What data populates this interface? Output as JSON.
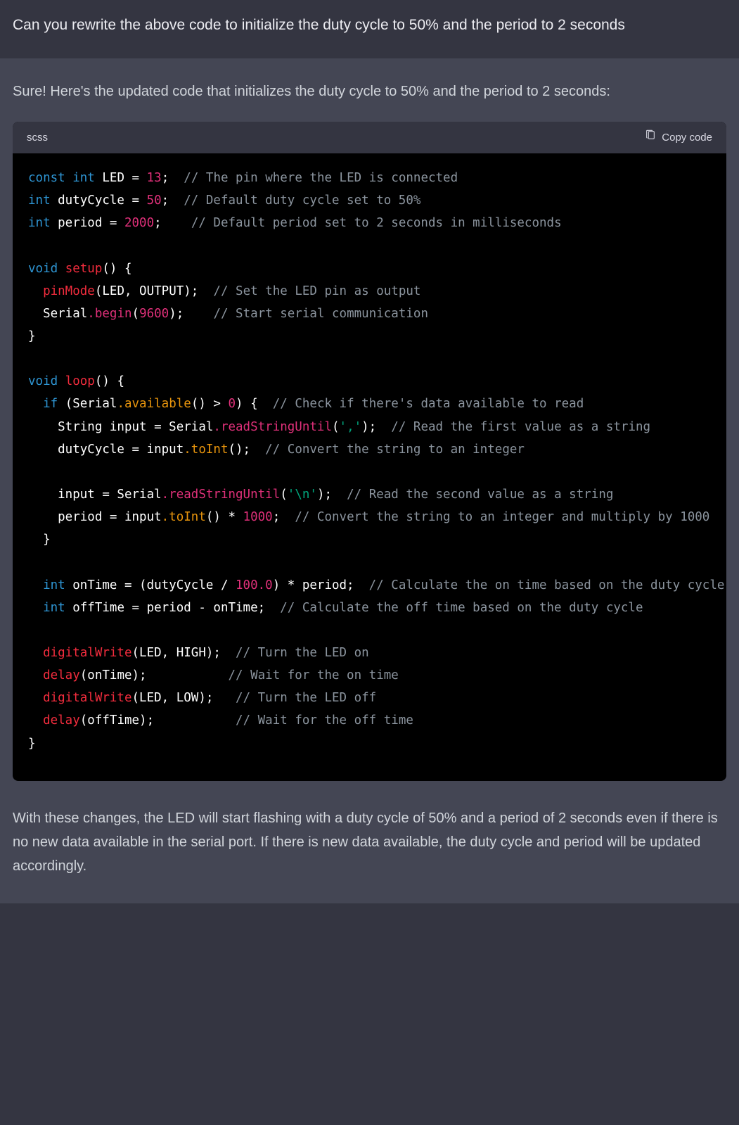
{
  "user": {
    "text": "Can you rewrite the above code to initialize the duty cycle to 50% and the period to 2 seconds"
  },
  "assistant": {
    "intro": "Sure! Here's the updated code that initializes the duty cycle to 50% and the period to 2 seconds:",
    "outro": "With these changes, the LED will start flashing with a duty cycle of 50% and a period of 2 seconds even if there is no new data available in the serial port. If there is new data available, the duty cycle and period will be updated accordingly."
  },
  "code_block": {
    "language": "scss",
    "copy_label": "Copy code",
    "lines": [
      [
        [
          "kw",
          "const"
        ],
        [
          "id",
          " "
        ],
        [
          "type",
          "int"
        ],
        [
          "id",
          " LED = "
        ],
        [
          "num",
          "13"
        ],
        [
          "id",
          ";  "
        ],
        [
          "com",
          "// The pin where the LED is connected"
        ]
      ],
      [
        [
          "type",
          "int"
        ],
        [
          "id",
          " dutyCycle = "
        ],
        [
          "num",
          "50"
        ],
        [
          "id",
          ";  "
        ],
        [
          "com",
          "// Default duty cycle set to 50%"
        ]
      ],
      [
        [
          "type",
          "int"
        ],
        [
          "id",
          " period = "
        ],
        [
          "num",
          "2000"
        ],
        [
          "id",
          ";    "
        ],
        [
          "com",
          "// Default period set to 2 seconds in milliseconds"
        ]
      ],
      [],
      [
        [
          "type",
          "void"
        ],
        [
          "id",
          " "
        ],
        [
          "fn",
          "setup"
        ],
        [
          "id",
          "() {"
        ]
      ],
      [
        [
          "id",
          "  "
        ],
        [
          "fn",
          "pinMode"
        ],
        [
          "id",
          "(LED, OUTPUT);  "
        ],
        [
          "com",
          "// Set the LED pin as output"
        ]
      ],
      [
        [
          "id",
          "  Serial"
        ],
        [
          "meth",
          ".begin"
        ],
        [
          "id",
          "("
        ],
        [
          "num",
          "9600"
        ],
        [
          "id",
          ");    "
        ],
        [
          "com",
          "// Start serial communication"
        ]
      ],
      [
        [
          "id",
          "}"
        ]
      ],
      [],
      [
        [
          "type",
          "void"
        ],
        [
          "id",
          " "
        ],
        [
          "fn",
          "loop"
        ],
        [
          "id",
          "() {"
        ]
      ],
      [
        [
          "id",
          "  "
        ],
        [
          "kw",
          "if"
        ],
        [
          "id",
          " (Serial"
        ],
        [
          "call",
          ".available"
        ],
        [
          "id",
          "() > "
        ],
        [
          "num",
          "0"
        ],
        [
          "id",
          ") {  "
        ],
        [
          "com",
          "// Check if there's data available to read"
        ]
      ],
      [
        [
          "id",
          "    String input = Serial"
        ],
        [
          "meth",
          ".readStringUntil"
        ],
        [
          "id",
          "("
        ],
        [
          "str",
          "','"
        ],
        [
          "id",
          ");  "
        ],
        [
          "com",
          "// Read the first value as a string"
        ]
      ],
      [
        [
          "id",
          "    dutyCycle = input"
        ],
        [
          "call",
          ".toInt"
        ],
        [
          "id",
          "();  "
        ],
        [
          "com",
          "// Convert the string to an integer"
        ]
      ],
      [],
      [
        [
          "id",
          "    input = Serial"
        ],
        [
          "meth",
          ".readStringUntil"
        ],
        [
          "id",
          "("
        ],
        [
          "str",
          "'\\n'"
        ],
        [
          "id",
          ");  "
        ],
        [
          "com",
          "// Read the second value as a string"
        ]
      ],
      [
        [
          "id",
          "    period = input"
        ],
        [
          "call",
          ".toInt"
        ],
        [
          "id",
          "() * "
        ],
        [
          "num",
          "1000"
        ],
        [
          "id",
          ";  "
        ],
        [
          "com",
          "// Convert the string to an integer and multiply by 1000"
        ]
      ],
      [
        [
          "id",
          "  }"
        ]
      ],
      [],
      [
        [
          "id",
          "  "
        ],
        [
          "type",
          "int"
        ],
        [
          "id",
          " onTime = (dutyCycle / "
        ],
        [
          "num",
          "100.0"
        ],
        [
          "id",
          ") * period;  "
        ],
        [
          "com",
          "// Calculate the on time based on the duty cycle"
        ]
      ],
      [
        [
          "id",
          "  "
        ],
        [
          "type",
          "int"
        ],
        [
          "id",
          " offTime = period - onTime;  "
        ],
        [
          "com",
          "// Calculate the off time based on the duty cycle"
        ]
      ],
      [],
      [
        [
          "id",
          "  "
        ],
        [
          "fn",
          "digitalWrite"
        ],
        [
          "id",
          "(LED, HIGH);  "
        ],
        [
          "com",
          "// Turn the LED on"
        ]
      ],
      [
        [
          "id",
          "  "
        ],
        [
          "fn",
          "delay"
        ],
        [
          "id",
          "(onTime);           "
        ],
        [
          "com",
          "// Wait for the on time"
        ]
      ],
      [
        [
          "id",
          "  "
        ],
        [
          "fn",
          "digitalWrite"
        ],
        [
          "id",
          "(LED, LOW);   "
        ],
        [
          "com",
          "// Turn the LED off"
        ]
      ],
      [
        [
          "id",
          "  "
        ],
        [
          "fn",
          "delay"
        ],
        [
          "id",
          "(offTime);           "
        ],
        [
          "com",
          "// Wait for the off time"
        ]
      ],
      [
        [
          "id",
          "}"
        ]
      ]
    ]
  }
}
